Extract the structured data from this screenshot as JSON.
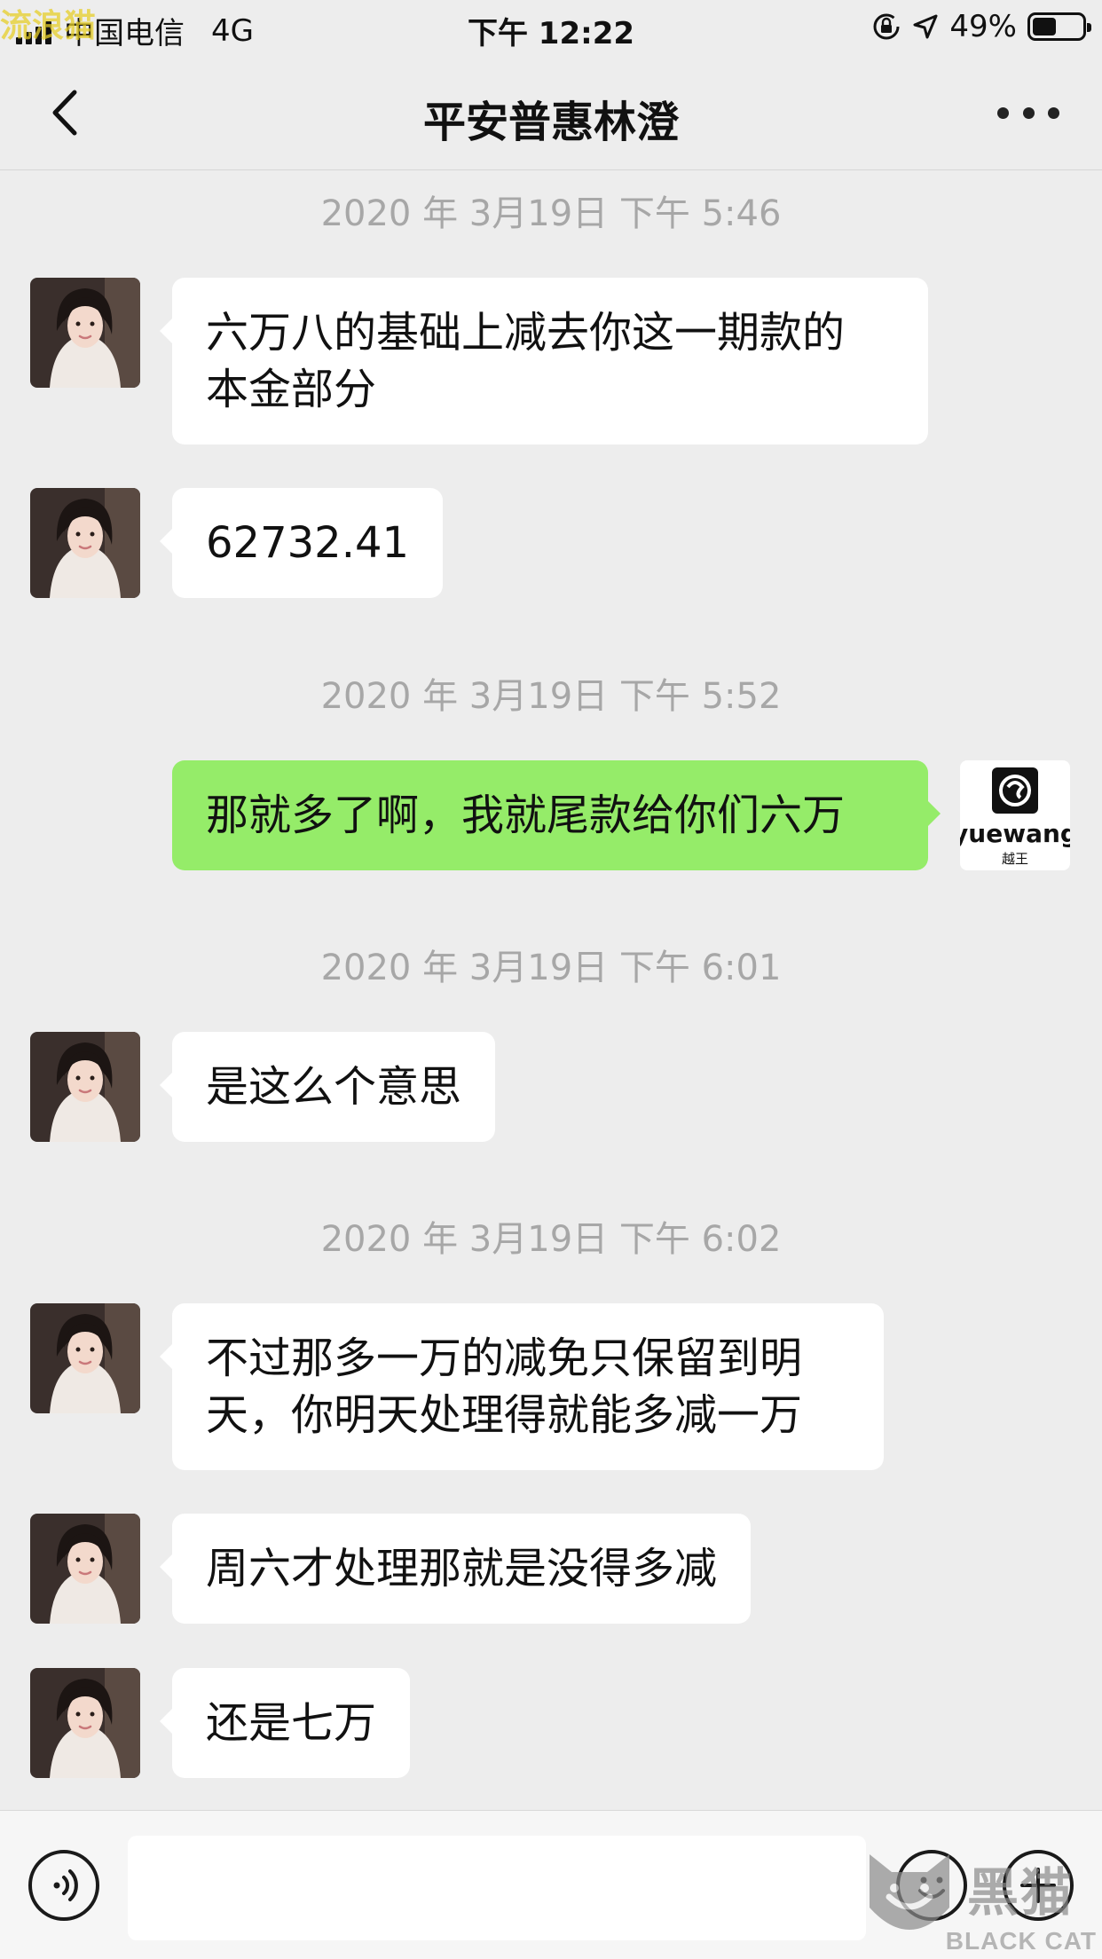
{
  "status_bar": {
    "carrier": "中国电信",
    "network": "4G",
    "time": "下午 12:22",
    "battery": "49%",
    "battery_level": 0.49,
    "watermark": "流浪猫"
  },
  "nav": {
    "title": "平安普惠林澄",
    "back_icon": "chevron-left-icon",
    "more_icon": "more-dots-icon"
  },
  "messages": [
    {
      "type": "time",
      "text": "2020 年 3月19日 下午 5:46"
    },
    {
      "type": "msg",
      "side": "left",
      "lines": [
        "六万八的基础上减去你这一期款的",
        "本金部分"
      ]
    },
    {
      "type": "msg",
      "side": "left",
      "lines": [
        "62732.41"
      ]
    },
    {
      "type": "time",
      "text": "2020 年 3月19日 下午 5:52"
    },
    {
      "type": "msg",
      "side": "right",
      "lines": [
        "那就多了啊，我就尾款给你们六万"
      ]
    },
    {
      "type": "time",
      "text": "2020 年 3月19日 下午 6:01"
    },
    {
      "type": "msg",
      "side": "left",
      "lines": [
        "是这么个意思"
      ]
    },
    {
      "type": "time",
      "text": "2020 年 3月19日 下午 6:02"
    },
    {
      "type": "msg",
      "side": "left",
      "lines": [
        "不过那多一万的减免只保留到明",
        "天，你明天处理得就能多减一万"
      ]
    },
    {
      "type": "msg",
      "side": "left",
      "lines": [
        "周六才处理那就是没得多减"
      ]
    },
    {
      "type": "msg",
      "side": "left",
      "lines": [
        "还是七万"
      ]
    }
  ],
  "self_avatar": {
    "brand": "yuewang",
    "sub": "越王"
  },
  "input_bar": {
    "value": "",
    "voice_icon": "voice-icon",
    "emoji_icon": "emoji-icon",
    "plus_icon": "plus-icon"
  },
  "watermark_br": {
    "text": "BLACK CAT",
    "chars": "黑猫"
  },
  "colors": {
    "background": "#ededed",
    "bubble_self": "#95ec69",
    "bubble_other": "#ffffff",
    "timestamp": "#a7a7a7"
  }
}
